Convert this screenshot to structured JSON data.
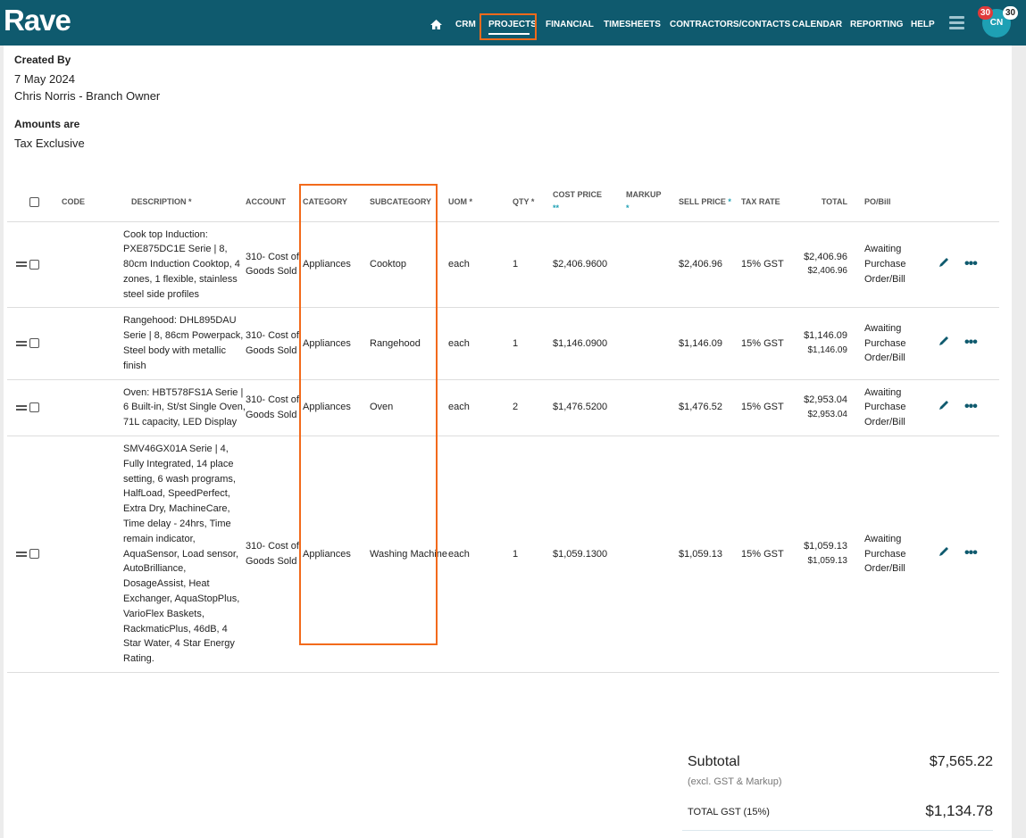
{
  "app": {
    "logo": "Rave",
    "nav": [
      "CRM",
      "PROJECTS",
      "FINANCIAL",
      "TIMESHEETS",
      "CONTRACTORS/CONTACTS",
      "CALENDAR",
      "REPORTING",
      "HELP"
    ],
    "active_nav": "PROJECTS",
    "avatar": "CN",
    "badge_red": "30",
    "badge_white": "30"
  },
  "info": {
    "created_by_label": "Created By",
    "created_date": "7 May 2024",
    "created_by": "Chris Norris - Branch Owner",
    "amounts_label": "Amounts are",
    "amounts_value": "Tax Exclusive"
  },
  "table": {
    "headers": {
      "code": "CODE",
      "description": "DESCRIPTION",
      "account": "ACCOUNT",
      "category": "CATEGORY",
      "subcategory": "SUBCATEGORY",
      "uom": "UOM",
      "qty": "QTY",
      "cost": "COST PRICE",
      "cost_mark": "**",
      "markup": "MARKUP",
      "markup_mark": "*",
      "sell": "SELL PRICE",
      "req": "*",
      "tax": "TAX RATE",
      "total": "TOTAL",
      "po": "PO/Bill"
    },
    "rows": [
      {
        "description": "Cook top Induction: PXE875DC1E Serie | 8, 80cm Induction Cooktop, 4 zones, 1 flexible, stainless steel side profiles",
        "account": "310- Cost of Goods Sold",
        "category": "Appliances",
        "subcategory": "Cooktop",
        "uom": "each",
        "qty": "1",
        "cost": "$2,406.9600",
        "markup": "",
        "sell": "$2,406.96",
        "tax": "15% GST",
        "total": "$2,406.96",
        "total_sub": "$2,406.96",
        "po": "Awaiting Purchase Order/Bill"
      },
      {
        "description": "Rangehood: DHL895DAU Serie | 8, 86cm Powerpack, Steel body with metallic finish",
        "account": "310- Cost of Goods Sold",
        "category": "Appliances",
        "subcategory": "Rangehood",
        "uom": "each",
        "qty": "1",
        "cost": "$1,146.0900",
        "markup": "",
        "sell": "$1,146.09",
        "tax": "15% GST",
        "total": "$1,146.09",
        "total_sub": "$1,146.09",
        "po": "Awaiting Purchase Order/Bill"
      },
      {
        "description": "Oven: HBT578FS1A Serie | 6 Built-in, St/st Single Oven, 71L capacity, LED Display",
        "account": "310- Cost of Goods Sold",
        "category": "Appliances",
        "subcategory": "Oven",
        "uom": "each",
        "qty": "2",
        "cost": "$1,476.5200",
        "markup": "",
        "sell": "$1,476.52",
        "tax": "15% GST",
        "total": "$2,953.04",
        "total_sub": "$2,953.04",
        "po": "Awaiting Purchase Order/Bill"
      },
      {
        "description": "SMV46GX01A Serie | 4, Fully Integrated, 14 place setting, 6 wash programs, HalfLoad, SpeedPerfect, Extra Dry, MachineCare, Time delay - 24hrs, Time remain indicator, AquaSensor, Load sensor, AutoBrilliance, DosageAssist, Heat Exchanger, AquaStopPlus, VarioFlex Baskets, RackmaticPlus, 46dB, 4 Star Water, 4 Star Energy Rating.",
        "account": "310- Cost of Goods Sold",
        "category": "Appliances",
        "subcategory": "Washing Machine",
        "uom": "each",
        "qty": "1",
        "cost": "$1,059.1300",
        "markup": "",
        "sell": "$1,059.13",
        "tax": "15% GST",
        "total": "$1,059.13",
        "total_sub": "$1,059.13",
        "po": "Awaiting Purchase Order/Bill"
      }
    ]
  },
  "totals": {
    "subtotal_label": "Subtotal",
    "subtotal_note": "(excl. GST & Markup)",
    "subtotal": "$7,565.22",
    "gst_label": "TOTAL GST (15%)",
    "gst": "$1,134.78"
  }
}
